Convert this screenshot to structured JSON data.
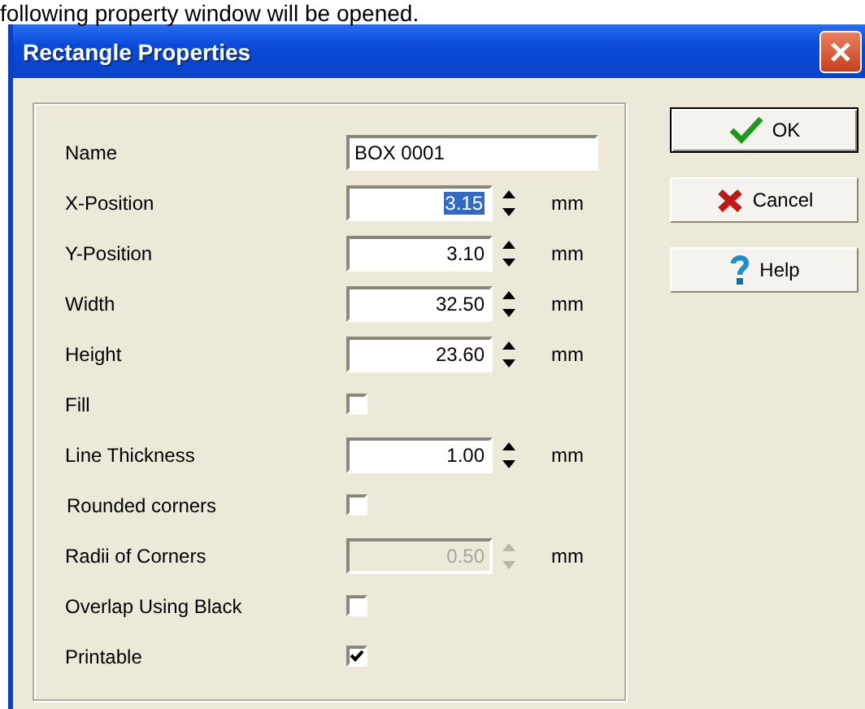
{
  "caption": "following property window will be opened.",
  "window": {
    "title": "Rectangle Properties"
  },
  "fields": [
    {
      "kind": "text",
      "label": "Name",
      "value": "BOX 0001"
    },
    {
      "kind": "spin",
      "label": "X-Position",
      "value": "3.15",
      "unit": "mm",
      "selected": true,
      "disabled": false
    },
    {
      "kind": "spin",
      "label": "Y-Position",
      "value": "3.10",
      "unit": "mm",
      "selected": false,
      "disabled": false
    },
    {
      "kind": "spin",
      "label": "Width",
      "value": "32.50",
      "unit": "mm",
      "selected": false,
      "disabled": false
    },
    {
      "kind": "spin",
      "label": "Height",
      "value": "23.60",
      "unit": "mm",
      "selected": false,
      "disabled": false
    },
    {
      "kind": "check",
      "label": "Fill",
      "checked": false
    },
    {
      "kind": "spin",
      "label": "Line Thickness",
      "value": "1.00",
      "unit": "mm",
      "selected": false,
      "disabled": false
    },
    {
      "kind": "check",
      "label": "Rounded corners",
      "checked": false
    },
    {
      "kind": "spin",
      "label": "Radii of Corners",
      "value": "0.50",
      "unit": "mm",
      "selected": false,
      "disabled": true
    },
    {
      "kind": "check",
      "label": "Overlap Using Black",
      "checked": false
    },
    {
      "kind": "check",
      "label": "Printable",
      "checked": true
    }
  ],
  "buttons": [
    {
      "kind": "ok",
      "label": "OK",
      "default": true
    },
    {
      "kind": "cancel",
      "label": "Cancel",
      "default": false
    },
    {
      "kind": "help",
      "label": "Help",
      "default": false
    }
  ]
}
